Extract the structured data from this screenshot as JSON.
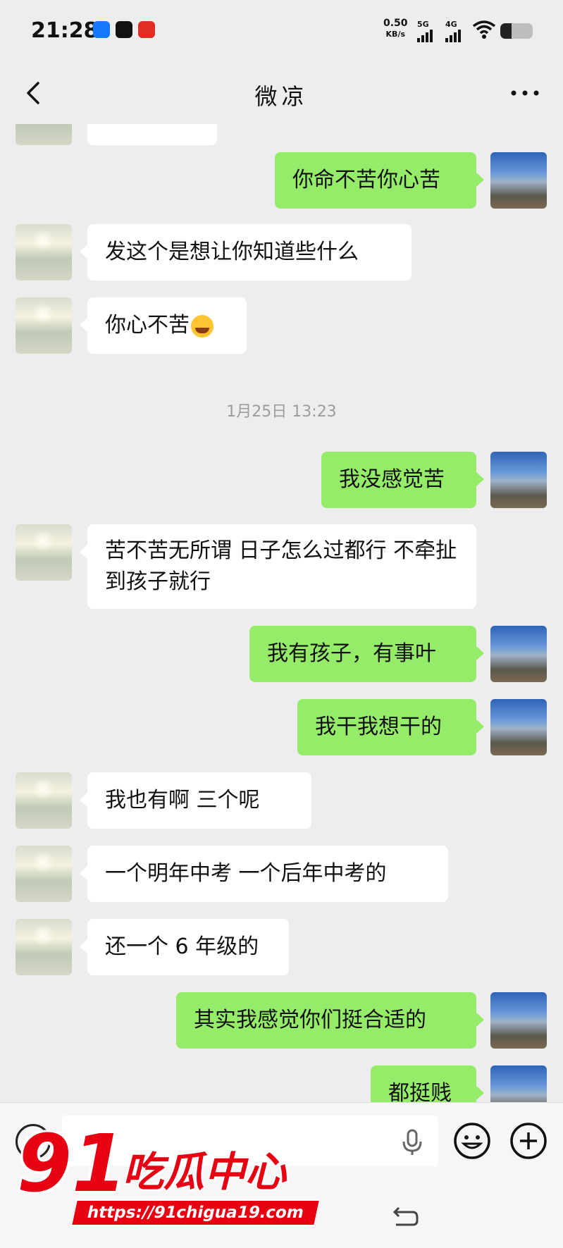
{
  "status_bar": {
    "time": "21:28",
    "net_speed_value": "0.50",
    "net_speed_unit": "KB/s",
    "signal_1_label": "5G",
    "signal_2_label": "4G",
    "battery_level": 0.35,
    "app_icons": [
      "alipay-icon",
      "douyin-icon",
      "pinduoduo-icon"
    ]
  },
  "header": {
    "title": "微凉",
    "back_icon": "chevron-left-icon",
    "more_icon": "more-dots-icon"
  },
  "messages": [
    {
      "side": "me",
      "text": "你命不苦你心苦"
    },
    {
      "side": "friend",
      "text": "发这个是想让你知道些什么"
    },
    {
      "side": "friend",
      "text": "你心不苦",
      "emoji": "tears-of-joy-emoji"
    },
    {
      "type": "time",
      "text": "1月25日 13:23"
    },
    {
      "side": "me",
      "text": "我没感觉苦"
    },
    {
      "side": "friend",
      "text": "苦不苦无所谓  日子怎么过都行 不牵扯到孩子就行"
    },
    {
      "side": "me",
      "text": "我有孩子，有事叶"
    },
    {
      "side": "me",
      "text": "我干我想干的"
    },
    {
      "side": "friend",
      "text": "我也有啊  三个呢"
    },
    {
      "side": "friend",
      "text": "一个明年中考  一个后年中考的"
    },
    {
      "side": "friend",
      "text": "还一个 6 年级的"
    },
    {
      "side": "me",
      "text": "其实我感觉你们挺合适的"
    },
    {
      "side": "me",
      "text": "都挺贱"
    }
  ],
  "input_bar": {
    "voice_icon": "voice-mode-icon",
    "mic_icon": "microphone-icon",
    "emoji_icon": "emoji-icon",
    "plus_icon": "plus-icon"
  },
  "watermark": {
    "number": "91",
    "name": "吃瓜中心",
    "url": "https://91chigua19.com"
  },
  "colors": {
    "my_bubble": "#95ec69",
    "friend_bubble": "#ffffff",
    "background": "#ededed",
    "watermark_red": "#e60012"
  }
}
